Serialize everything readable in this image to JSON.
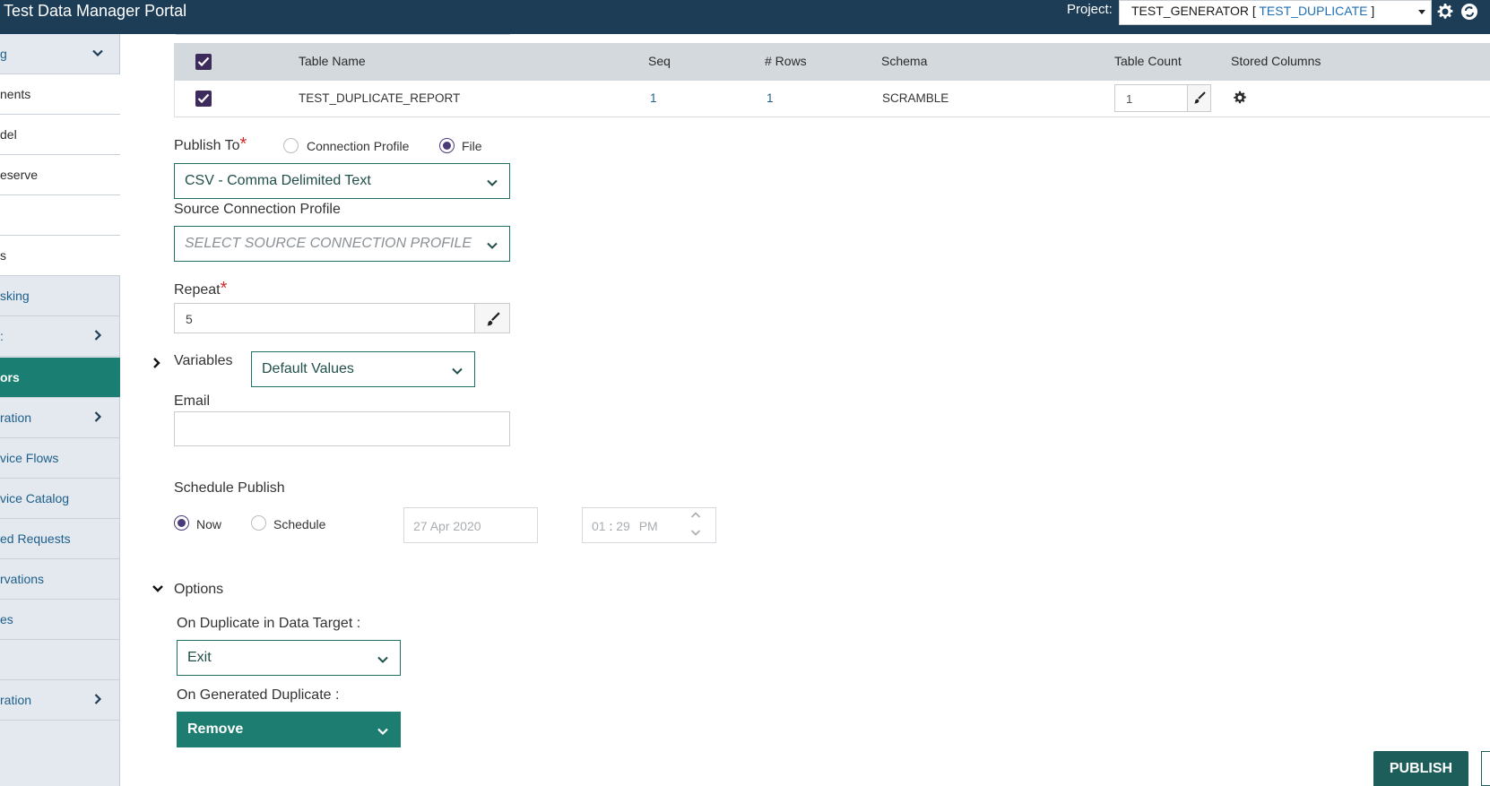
{
  "header": {
    "title": "Test Data Manager Portal",
    "project_label": "Project:",
    "project_name": "TEST_GENERATOR [",
    "project_sub": "TEST_DUPLICATE",
    "project_close": "]"
  },
  "sidebar": {
    "items": [
      {
        "label": "g",
        "has_chevron": "down"
      },
      {
        "label": "nents"
      },
      {
        "label": "del"
      },
      {
        "label": "eserve"
      },
      {
        "label": ""
      },
      {
        "label": "s"
      },
      {
        "label": "sking"
      },
      {
        "label": ":",
        "has_chevron": "right"
      },
      {
        "label": "ors",
        "active": true
      },
      {
        "label": "ration",
        "has_chevron": "right"
      },
      {
        "label": "vice Flows"
      },
      {
        "label": "vice Catalog"
      },
      {
        "label": "ed Requests"
      },
      {
        "label": "rvations"
      },
      {
        "label": "es"
      },
      {
        "label": ""
      },
      {
        "label": "ration",
        "has_chevron": "right"
      }
    ]
  },
  "table": {
    "headers": [
      "Table Name",
      "Seq",
      "# Rows",
      "Schema",
      "Table Count",
      "Stored Columns"
    ],
    "rows": [
      {
        "table_name": "TEST_DUPLICATE_REPORT",
        "seq": "1",
        "rows": "1",
        "schema": "SCRAMBLE",
        "table_count": "1"
      }
    ]
  },
  "form": {
    "publish_to_label": "Publish To",
    "required_mark": "*",
    "publish_options": [
      "Connection Profile",
      "File"
    ],
    "publish_selected": "File",
    "file_format": "CSV - Comma Delimited Text",
    "source_profile_label": "Source Connection Profile",
    "source_profile_placeholder": "SELECT SOURCE CONNECTION PROFILE",
    "repeat_label": "Repeat",
    "repeat_value": "5",
    "variables_label": "Variables",
    "variables_value": "Default Values",
    "email_label": "Email",
    "email_value": "",
    "schedule_label": "Schedule Publish",
    "schedule_options": [
      "Now",
      "Schedule"
    ],
    "schedule_selected": "Now",
    "date_value": "27 Apr 2020",
    "time_hour": "01",
    "time_sep": ":",
    "time_min": "29",
    "time_ampm": "PM",
    "options_label": "Options",
    "dup_target_label": "On Duplicate in Data Target :",
    "dup_target_value": "Exit",
    "gen_dup_label": "On Generated Duplicate :",
    "gen_dup_value": "Remove",
    "publish_button": "PUBLISH"
  },
  "colors": {
    "header_bg": "#1d3c55",
    "accent_teal": "#1d7d71",
    "checkbox": "#3d2b5c",
    "sidebar_bg": "#e4e9f0",
    "required": "#d32b2b"
  }
}
